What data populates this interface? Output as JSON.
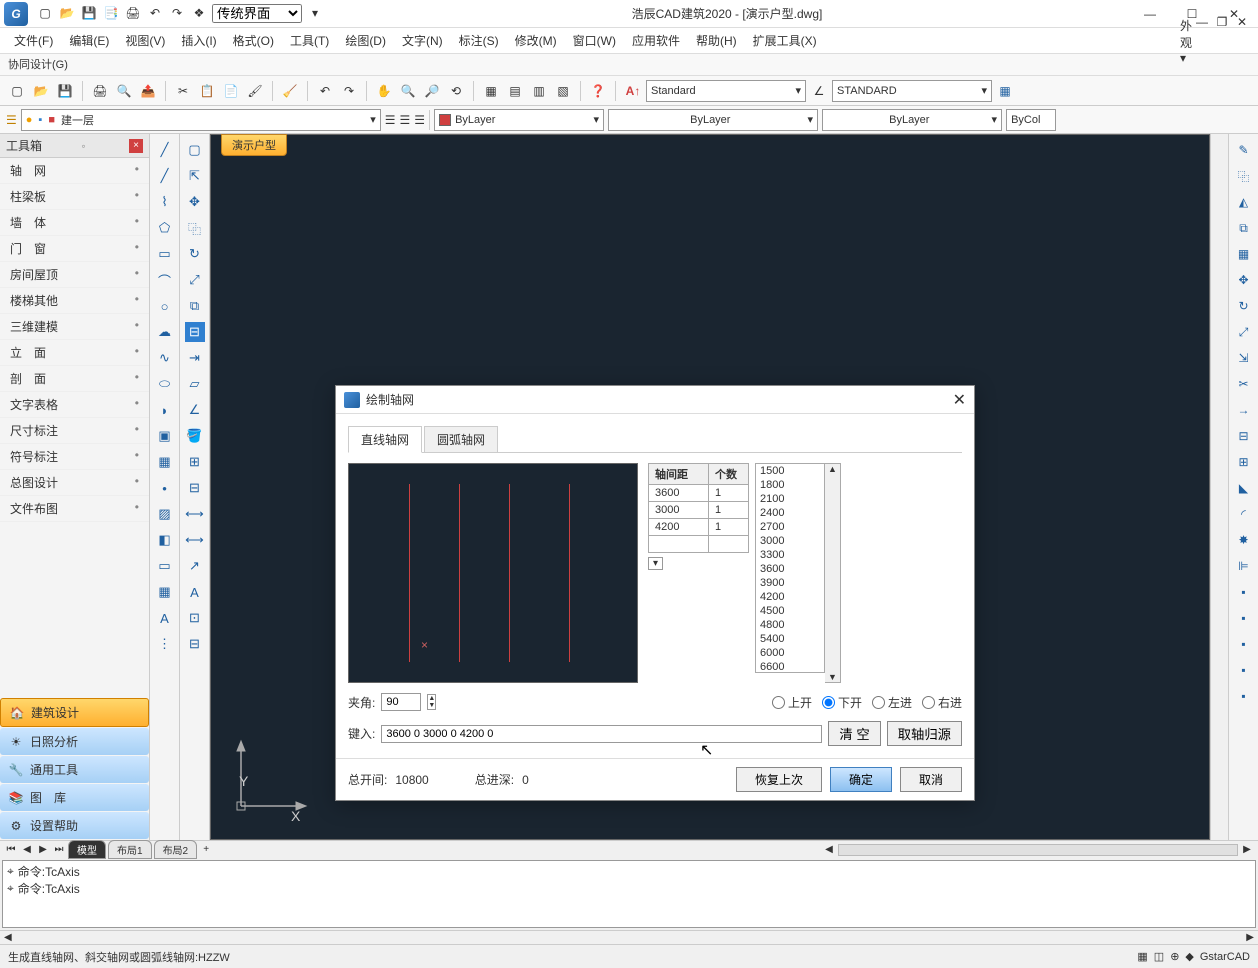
{
  "titlebar": {
    "app_title": "浩辰CAD建筑2020 - [演示户型.dwg]",
    "dropdown": "传统界面"
  },
  "menubar": {
    "items": [
      "文件(F)",
      "编辑(E)",
      "视图(V)",
      "插入(I)",
      "格式(O)",
      "工具(T)",
      "绘图(D)",
      "文字(N)",
      "标注(S)",
      "修改(M)",
      "窗口(W)",
      "应用软件",
      "帮助(H)",
      "扩展工具(X)"
    ],
    "right": "外观 ▾"
  },
  "subbar": {
    "text": "协同设计(G)"
  },
  "toolbar1": {
    "textstyle": "Standard",
    "dimstyle": "STANDARD"
  },
  "toolbar2": {
    "layer": "建一层",
    "color": "ByLayer",
    "ltype": "ByLayer",
    "lweight": "ByLayer",
    "bycol": "ByCol"
  },
  "leftpanel": {
    "title": "工具箱",
    "items": [
      "轴　网",
      "柱梁板",
      "墙　体",
      "门　窗",
      "房间屋顶",
      "楼梯其他",
      "三维建模",
      "立　面",
      "剖　面",
      "文字表格",
      "尺寸标注",
      "符号标注",
      "总图设计",
      "文件布图"
    ],
    "cats": [
      {
        "label": "建筑设计",
        "icon": "🏠",
        "active": true
      },
      {
        "label": "日照分析",
        "icon": "☀"
      },
      {
        "label": "通用工具",
        "icon": "🔧"
      },
      {
        "label": "图　库",
        "icon": "📚"
      },
      {
        "label": "设置帮助",
        "icon": "⚙"
      }
    ]
  },
  "canvas": {
    "doctab": "演示户型"
  },
  "modeltabs": {
    "tabs": [
      "模型",
      "布局1",
      "布局2"
    ]
  },
  "cmd": {
    "line1": "命令:TcAxis",
    "line2": "命令:TcAxis"
  },
  "status": {
    "left": "生成直线轴网、斜交轴网或圆弧线轴网:HZZW",
    "brand": "GstarCAD"
  },
  "dialog": {
    "title": "绘制轴网",
    "tabs": [
      "直线轴网",
      "圆弧轴网"
    ],
    "table": {
      "headers": [
        "轴间距",
        "个数"
      ],
      "rows": [
        {
          "dist": "3600",
          "n": "1"
        },
        {
          "dist": "3000",
          "n": "1"
        },
        {
          "dist": "4200",
          "n": "1"
        }
      ]
    },
    "sizes": [
      "1500",
      "1800",
      "2100",
      "2400",
      "2700",
      "3000",
      "3300",
      "3600",
      "3900",
      "4200",
      "4500",
      "4800",
      "5400",
      "6000",
      "6600"
    ],
    "angle_label": "夹角:",
    "angle_value": "90",
    "radios": [
      "上开",
      "下开",
      "左进",
      "右进"
    ],
    "radio_selected": 1,
    "input_label": "键入:",
    "input_value": "3600 0 3000 0 4200 0",
    "btn_clear": "清 空",
    "btn_pick": "取轴归源",
    "summary_left_label": "总开间:",
    "summary_left_value": "10800",
    "summary_right_label": "总进深:",
    "summary_right_value": "0",
    "btn_restore": "恢复上次",
    "btn_ok": "确定",
    "btn_cancel": "取消"
  }
}
